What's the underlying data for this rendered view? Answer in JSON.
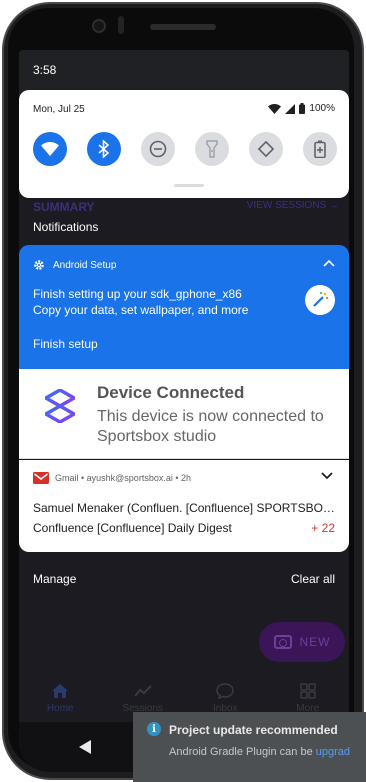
{
  "status_bar": {
    "time": "3:58"
  },
  "quick_settings": {
    "date": "Mon, Jul 25",
    "battery": "100%",
    "tiles": [
      {
        "name": "wifi",
        "state": "on"
      },
      {
        "name": "bluetooth",
        "state": "on"
      },
      {
        "name": "do-not-disturb",
        "state": "off"
      },
      {
        "name": "flashlight",
        "state": "off"
      },
      {
        "name": "auto-rotate",
        "state": "off"
      },
      {
        "name": "battery-saver",
        "state": "off"
      }
    ]
  },
  "background_app": {
    "summary_label": "SUMMARY",
    "view_sessions_label": "VIEW SESSIONS →",
    "new_button": "NEW",
    "tabs": [
      "Home",
      "Sessions",
      "Inbox",
      "More"
    ]
  },
  "notifications_header": "Notifications",
  "notifications": {
    "setup": {
      "app_name": "Android Setup",
      "line1": "Finish setting up your sdk_gphone_x86",
      "line2": "Copy your data, set wallpaper, and more",
      "action": "Finish setup"
    },
    "device": {
      "title": "Device Connected",
      "body_line1": "This device is now connected to",
      "body_line2": "Sportsbox studio"
    },
    "gmail": {
      "header": "Gmail • ayushk@sportsbox.ai • 2h",
      "line1": "Samuel Menaker (Confluen. [Confluence] SPORTSBOX...",
      "line2": "Confluence [Confluence] Daily Digest",
      "count": "+ 22"
    }
  },
  "footer": {
    "manage": "Manage",
    "clear_all": "Clear all"
  },
  "ide_balloon": {
    "title": "Project update recommended",
    "body_prefix": "Android Gradle Plugin can be ",
    "body_link": "upgrad"
  },
  "colors": {
    "accent": "#1a73e8",
    "alert": "#d93025",
    "balloon": "#4c5052"
  }
}
